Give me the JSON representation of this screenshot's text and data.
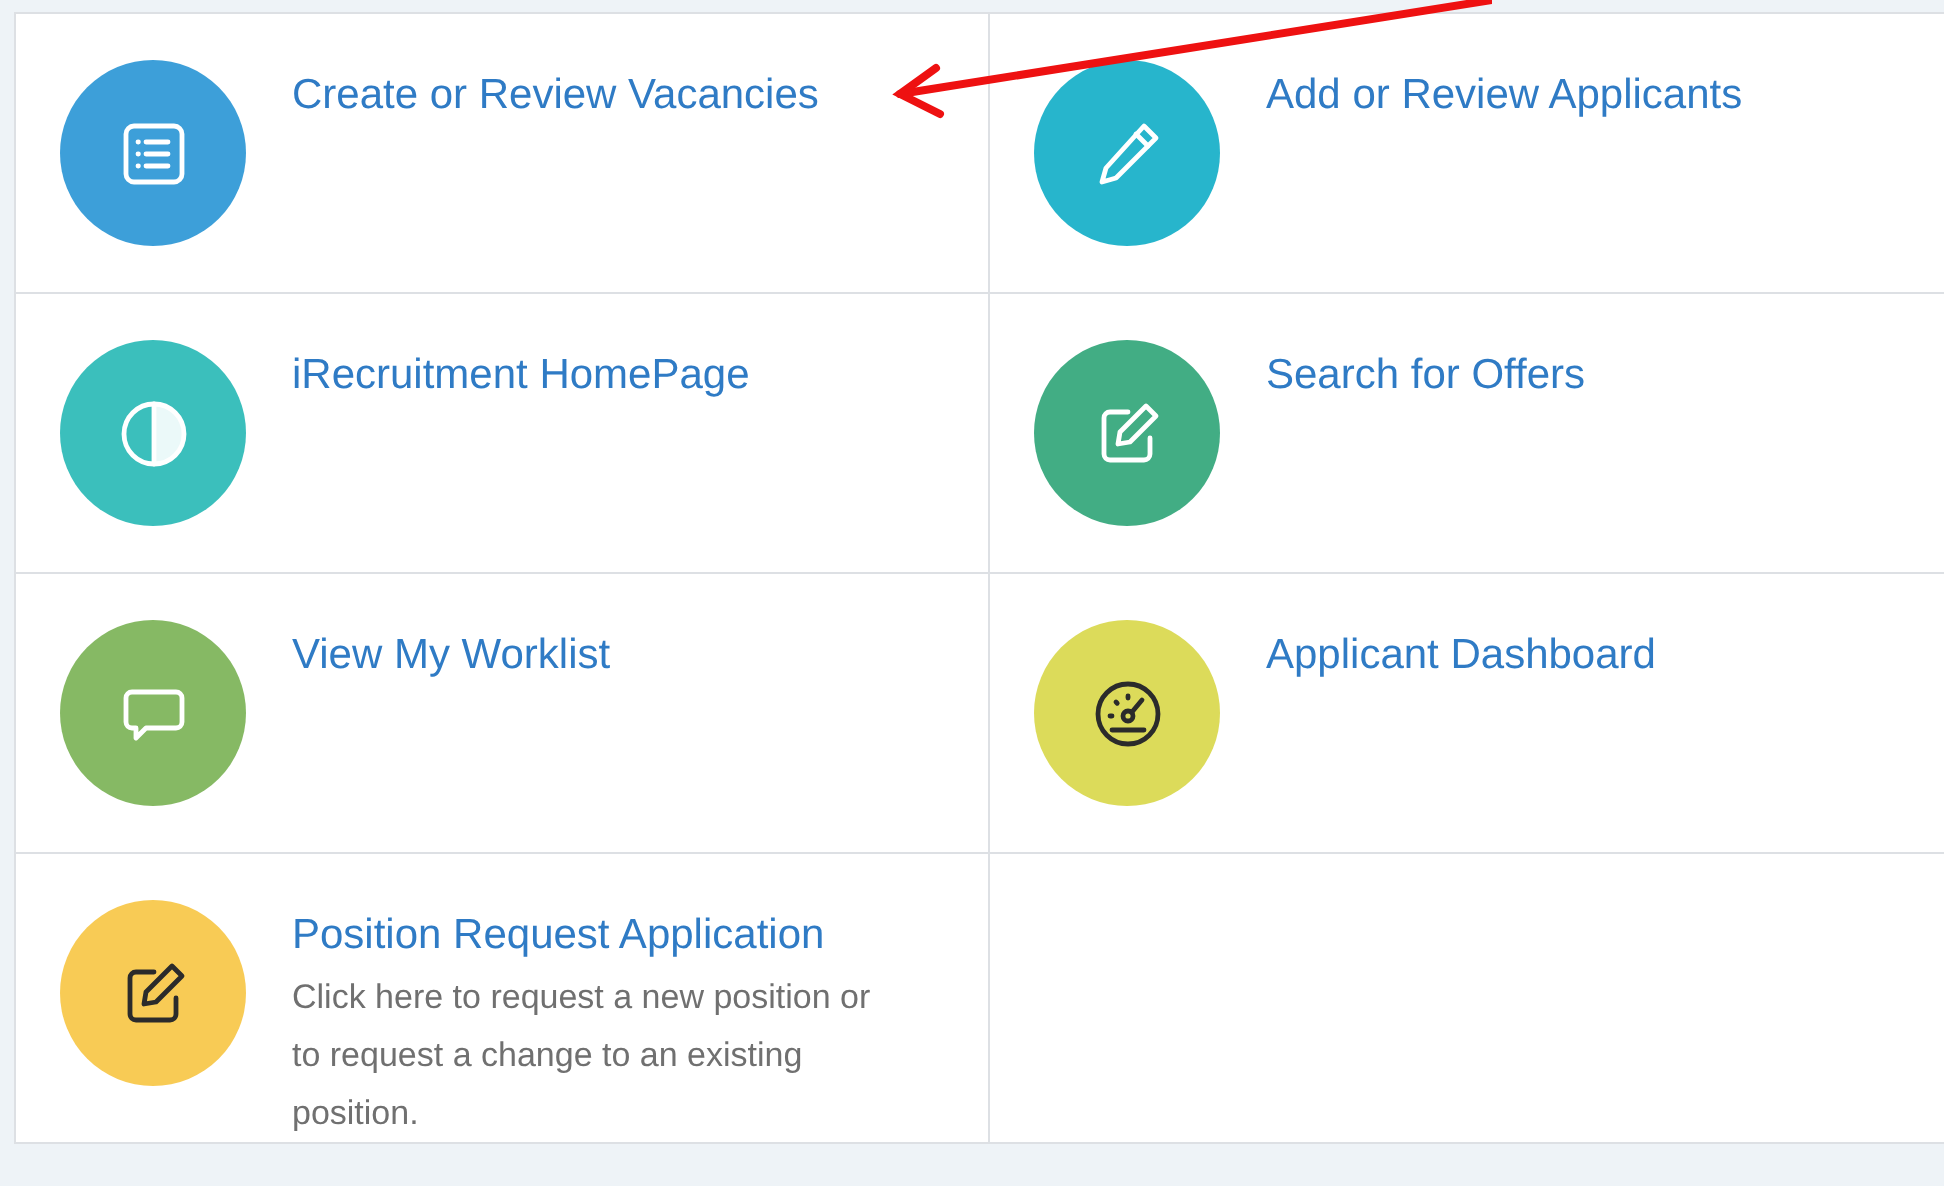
{
  "tiles": [
    {
      "title": "Create or Review Vacancies",
      "kind": "list",
      "color": "#3d9fd9",
      "dark_icon": false
    },
    {
      "title": "Add or Review Applicants",
      "kind": "pencil",
      "color": "#27b5cc",
      "dark_icon": false
    },
    {
      "title": "iRecruitment HomePage",
      "kind": "contrast",
      "color": "#3bbfbc",
      "dark_icon": false
    },
    {
      "title": "Search for Offers",
      "kind": "edit",
      "color": "#42ad84",
      "dark_icon": false
    },
    {
      "title": "View My Worklist",
      "kind": "chat",
      "color": "#86b964",
      "dark_icon": false
    },
    {
      "title": "Applicant Dashboard",
      "kind": "gauge",
      "color": "#dcdb5a",
      "dark_icon": true
    },
    {
      "title": "Position Request Application",
      "description": "Click here to request a new position or to request a change to an existing position.",
      "kind": "edit",
      "color": "#f8cb55",
      "dark_icon": true
    }
  ]
}
